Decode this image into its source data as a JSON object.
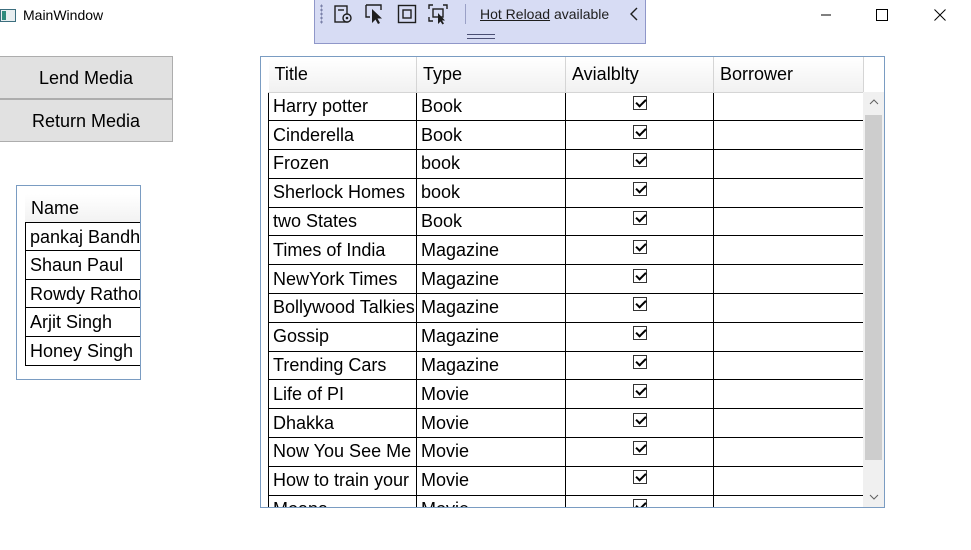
{
  "window": {
    "title": "MainWindow"
  },
  "devbar": {
    "hot_reload_link": "Hot Reload",
    "hot_reload_status": "available"
  },
  "actions": {
    "lend_label": "Lend Media",
    "return_label": "Return Media"
  },
  "borrowers": {
    "header": "Name",
    "items": [
      "pankaj Bandhu",
      "Shaun Paul",
      "Rowdy Rathore",
      "Arjit Singh",
      "Honey Singh"
    ]
  },
  "media": {
    "headers": [
      "Title",
      "Type",
      "Avialblty",
      "Borrower"
    ],
    "rows": [
      {
        "title": "Harry potter",
        "type": "Book",
        "available": true,
        "borrower": ""
      },
      {
        "title": "Cinderella",
        "type": "Book",
        "available": true,
        "borrower": ""
      },
      {
        "title": "Frozen",
        "type": "book",
        "available": true,
        "borrower": ""
      },
      {
        "title": "Sherlock Homes",
        "type": "book",
        "available": true,
        "borrower": ""
      },
      {
        "title": "two States",
        "type": "Book",
        "available": true,
        "borrower": ""
      },
      {
        "title": "Times of India",
        "type": "Magazine",
        "available": true,
        "borrower": ""
      },
      {
        "title": "NewYork Times",
        "type": "Magazine",
        "available": true,
        "borrower": ""
      },
      {
        "title": "Bollywood Talkies",
        "type": "Magazine",
        "available": true,
        "borrower": ""
      },
      {
        "title": "Gossip",
        "type": "Magazine",
        "available": true,
        "borrower": ""
      },
      {
        "title": "Trending Cars",
        "type": "Magazine",
        "available": true,
        "borrower": ""
      },
      {
        "title": "Life of PI",
        "type": "Movie",
        "available": true,
        "borrower": ""
      },
      {
        "title": "Dhakka",
        "type": "Movie",
        "available": true,
        "borrower": ""
      },
      {
        "title": "Now You See Me",
        "type": "Movie",
        "available": true,
        "borrower": ""
      },
      {
        "title": "How to train your",
        "type": "Movie",
        "available": true,
        "borrower": ""
      },
      {
        "title": "Moana",
        "type": "Movie",
        "available": true,
        "borrower": ""
      }
    ]
  },
  "icons": {
    "app": "app-icon",
    "minimize": "minimize-icon",
    "maximize": "maximize-icon",
    "close": "close-icon",
    "tools": [
      "live-visual-tree-icon",
      "select-element-icon",
      "display-layout-adorners-icon",
      "track-focus-icon"
    ],
    "collapse": "chevron-left-icon"
  },
  "colors": {
    "devbar_bg": "#d7dcf4",
    "button_bg": "#e1e1e1",
    "list_border": "#7a9cc2"
  }
}
